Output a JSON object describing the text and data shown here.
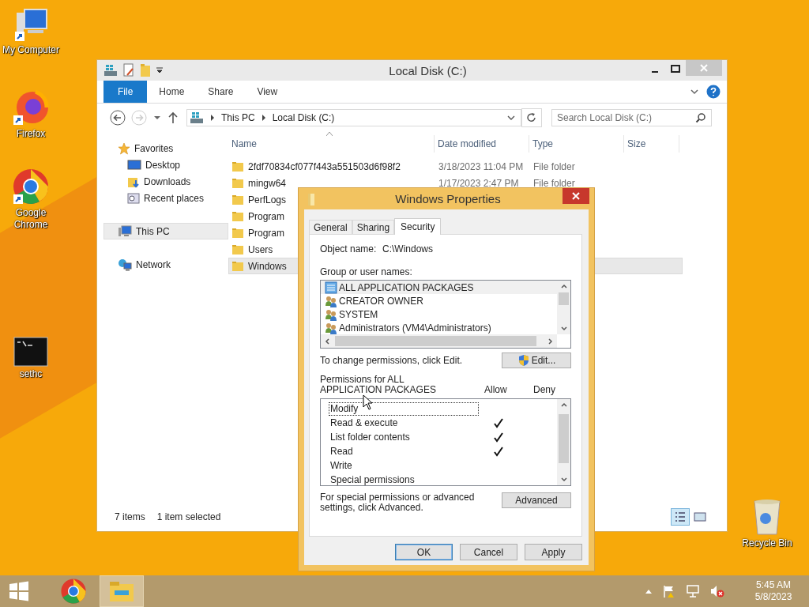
{
  "desktop_icons": [
    {
      "label": "My Computer",
      "kind": "computer"
    },
    {
      "label": "Firefox",
      "kind": "firefox"
    },
    {
      "label": "Google Chrome",
      "kind": "chrome"
    },
    {
      "label": "sethc",
      "kind": "console"
    },
    {
      "label": "Recycle Bin",
      "kind": "recycle"
    }
  ],
  "explorer": {
    "title": "Local Disk (C:)",
    "ribbon_tabs": [
      {
        "label": "File",
        "selected": true
      },
      {
        "label": "Home",
        "selected": false
      },
      {
        "label": "Share",
        "selected": false
      },
      {
        "label": "View",
        "selected": false
      }
    ],
    "breadcrumb": [
      "This PC",
      "Local Disk (C:)"
    ],
    "search": {
      "placeholder": "Search Local Disk (C:)"
    },
    "sidebar": {
      "items": [
        {
          "label": "Favorites",
          "kind": "star",
          "selected": false,
          "children": [
            {
              "label": "Desktop",
              "kind": "desktop",
              "selected": false
            },
            {
              "label": "Downloads",
              "kind": "downloads",
              "selected": false
            },
            {
              "label": "Recent places",
              "kind": "recent",
              "selected": false
            }
          ]
        },
        {
          "label": "This PC",
          "kind": "pc",
          "selected": true
        },
        {
          "label": "Network",
          "kind": "network",
          "selected": false
        }
      ]
    },
    "table": {
      "columns": [
        "Name",
        "Date modified",
        "Type",
        "Size"
      ],
      "rows": [
        {
          "name": "2fdf70834cf077f443a551503d6f98f2",
          "date": "3/18/2023 11:04 PM",
          "type": "File folder",
          "selected": false
        },
        {
          "name": "mingw64",
          "date": "1/17/2023 2:47 PM",
          "type": "File folder",
          "selected": false
        },
        {
          "name": "PerfLogs",
          "selected": false
        },
        {
          "name": "Program",
          "selected": false
        },
        {
          "name": "Program",
          "selected": false
        },
        {
          "name": "Users",
          "selected": false
        },
        {
          "name": "Windows",
          "selected": true
        }
      ]
    },
    "status_bar": {
      "count": "7 items",
      "selection": "1 item selected"
    }
  },
  "dialog": {
    "title": "Windows Properties",
    "tabs": [
      {
        "label": "General",
        "selected": false
      },
      {
        "label": "Sharing",
        "selected": false
      },
      {
        "label": "Security",
        "selected": true
      }
    ],
    "object_label": "Object name:",
    "object_value": "C:\\Windows",
    "group_label": "Group or user names:",
    "groups": [
      {
        "name": "ALL APPLICATION PACKAGES",
        "kind": "package",
        "selected": true
      },
      {
        "name": "CREATOR OWNER",
        "kind": "users",
        "selected": false
      },
      {
        "name": "SYSTEM",
        "kind": "users",
        "selected": false
      },
      {
        "name": "Administrators (VM4\\Administrators)",
        "kind": "users",
        "selected": false
      }
    ],
    "edit_hint": "To change permissions, click Edit.",
    "edit_button": "Edit...",
    "permissions_label": "Permissions for ALL APPLICATION PACKAGES",
    "allow_label": "Allow",
    "deny_label": "Deny",
    "permissions": [
      {
        "name": "Modify",
        "allow": false,
        "deny": false,
        "selected": true
      },
      {
        "name": "Read & execute",
        "allow": true,
        "deny": false,
        "selected": false
      },
      {
        "name": "List folder contents",
        "allow": true,
        "deny": false,
        "selected": false
      },
      {
        "name": "Read",
        "allow": true,
        "deny": false,
        "selected": false
      },
      {
        "name": "Write",
        "allow": false,
        "deny": false,
        "selected": false
      },
      {
        "name": "Special permissions",
        "allow": false,
        "deny": false,
        "selected": false
      }
    ],
    "advanced_hint": "For special permissions or advanced settings, click Advanced.",
    "advanced_button": "Advanced",
    "buttons": [
      {
        "label": "OK",
        "selected": true
      },
      {
        "label": "Cancel",
        "selected": false
      },
      {
        "label": "Apply",
        "selected": false
      }
    ]
  },
  "taskbar": {
    "time": "5:45 AM",
    "date": "5/8/2023"
  }
}
